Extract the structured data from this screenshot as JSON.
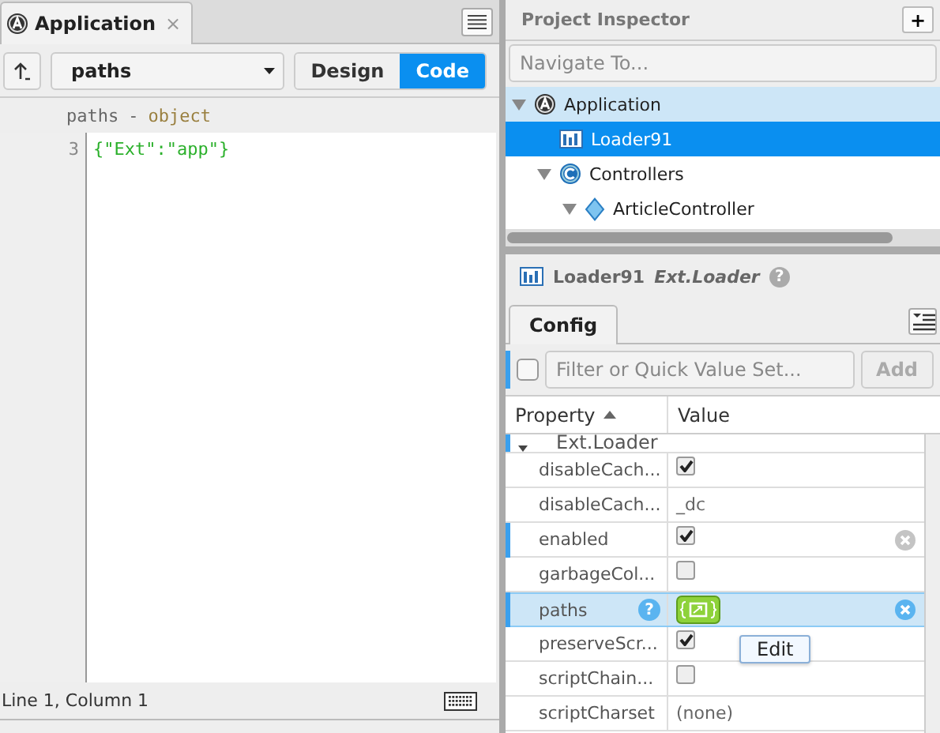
{
  "editor": {
    "tab": {
      "title": "Application",
      "close": "×",
      "selected": true
    },
    "path_select": {
      "value": "paths"
    },
    "view_tabs": [
      {
        "label": "Design",
        "selected": false
      },
      {
        "label": "Code",
        "selected": true
      }
    ],
    "header": {
      "name": "paths",
      "separator": "-",
      "type": "object"
    },
    "lines": [
      {
        "number": "3",
        "code": "{\"Ext\":\"app\"}"
      }
    ],
    "status_bar": "Line 1, Column 1"
  },
  "inspector": {
    "title": "Project Inspector",
    "add": "+",
    "navigate": {
      "placeholder": "Navigate To..."
    },
    "tree": [
      {
        "label": "Application",
        "kind": "app",
        "expanded": true,
        "selected": false,
        "hovered": true,
        "children": [
          {
            "label": "Loader91",
            "kind": "loader",
            "selected": true,
            "hovered": false
          },
          {
            "label": "Controllers",
            "kind": "controller",
            "expanded": true,
            "selected": false,
            "hovered": false,
            "children": [
              {
                "label": "ArticleController",
                "kind": "diamond",
                "expanded": true,
                "selected": false,
                "hovered": false
              }
            ]
          }
        ]
      }
    ]
  },
  "config": {
    "component": "Loader91",
    "class": "Ext.Loader",
    "help": "?",
    "tabs": [
      {
        "label": "Config",
        "selected": true
      }
    ],
    "filter": {
      "checked": false,
      "placeholder": "Filter or Quick Value Set...",
      "button": "Add"
    },
    "columns": [
      "Property",
      "Value"
    ],
    "group": "Ext.Loader",
    "rows": [
      {
        "name": "disableCach...",
        "kind": "checkbox",
        "checked": true,
        "modified": false,
        "selected": false
      },
      {
        "name": "disableCach...",
        "kind": "text",
        "value": "_dc",
        "modified": false,
        "selected": false
      },
      {
        "name": "enabled",
        "kind": "checkbox",
        "checked": true,
        "modified": true,
        "selected": false
      },
      {
        "name": "garbageCol...",
        "kind": "checkbox",
        "checked": false,
        "modified": false,
        "selected": false
      },
      {
        "name": "paths",
        "kind": "object",
        "modified": true,
        "selected": true,
        "help": "?"
      },
      {
        "name": "preserveScr...",
        "kind": "checkbox",
        "checked": true,
        "modified": false,
        "selected": false
      },
      {
        "name": "scriptChain...",
        "kind": "checkbox",
        "checked": false,
        "modified": false,
        "selected": false
      },
      {
        "name": "scriptCharset",
        "kind": "text",
        "value": "(none)",
        "modified": false,
        "selected": false
      }
    ],
    "tooltip": "Edit"
  }
}
